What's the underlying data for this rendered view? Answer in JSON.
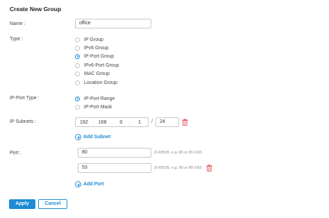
{
  "title": "Create New Group",
  "name": {
    "label": "Name :",
    "value": "office"
  },
  "type": {
    "label": "Type :",
    "options": [
      "IP Group",
      "IPv6 Group",
      "IP-Port Group",
      "IPv6-Port Group",
      "MAC Group",
      "Location Group"
    ],
    "selected": "IP-Port Group"
  },
  "ip_port_type": {
    "label": "IP-Port Type :",
    "options": [
      "IP-Port Range",
      "IP-Port Mask"
    ],
    "selected": "IP-Port Range"
  },
  "ip_subnets": {
    "label": "IP Subnets :",
    "octets": [
      "192",
      "168",
      "0",
      "1"
    ],
    "separator": ".",
    "mask_separator": "/",
    "mask": "24",
    "add_label": "Add Subnet"
  },
  "port": {
    "label": "Port :",
    "values": [
      "80",
      "53"
    ],
    "hint": "(0-65535, e.g. 80 or 80-100)",
    "add_label": "Add Port"
  },
  "buttons": {
    "apply": "Apply",
    "cancel": "Cancel"
  },
  "colors": {
    "accent": "#1e8bd3",
    "delete": "#e5525c"
  },
  "icons": {
    "add": "plus-circle-icon",
    "delete": "trash-icon"
  }
}
